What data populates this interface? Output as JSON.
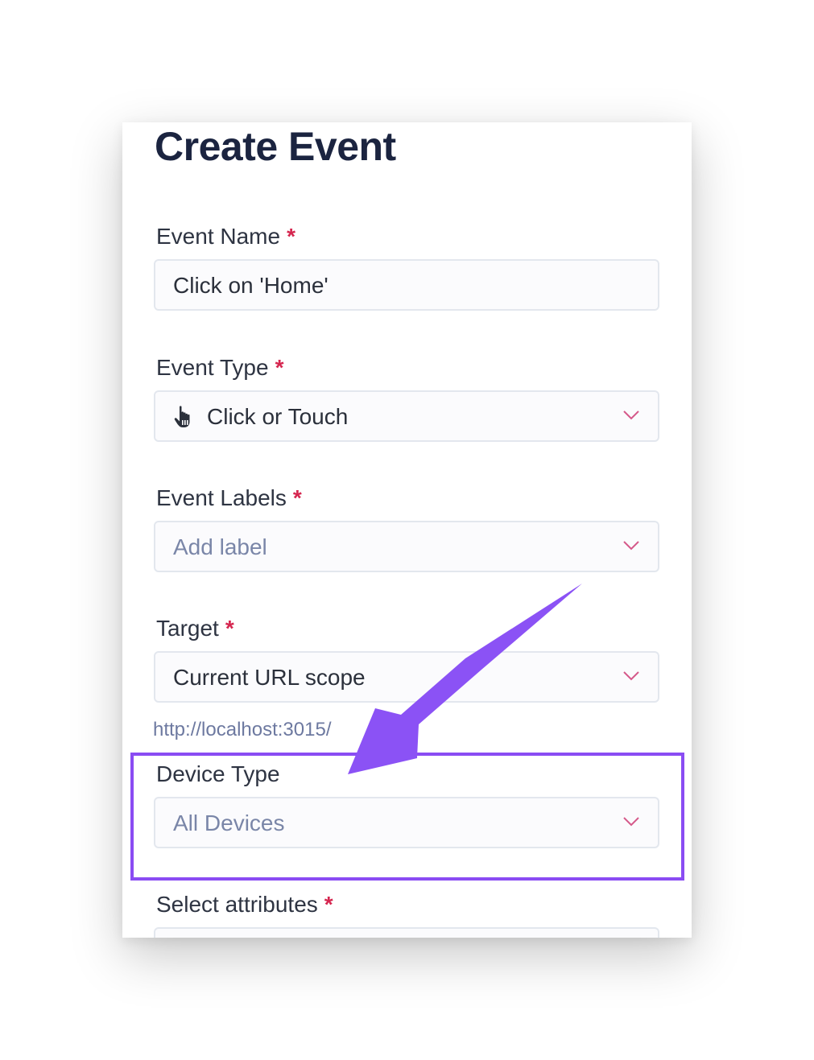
{
  "form": {
    "title": "Create Event",
    "required_marker": "*",
    "event_name": {
      "label": "Event Name",
      "value": "Click on 'Home'"
    },
    "event_type": {
      "label": "Event Type",
      "value": "Click or Touch",
      "icon": "pointer-hand-icon"
    },
    "event_labels": {
      "label": "Event Labels",
      "placeholder": "Add label"
    },
    "target": {
      "label": "Target",
      "value": "Current URL scope",
      "hint": "http://localhost:3015/"
    },
    "device_type": {
      "label": "Device Type",
      "value": "All Devices"
    },
    "select_attributes": {
      "label": "Select attributes"
    }
  },
  "annotation": {
    "highlight_color": "#8a4cf3",
    "arrow_color": "#8b52f5"
  },
  "colors": {
    "title": "#1b2440",
    "required": "#d5264f",
    "placeholder": "#7a86a8",
    "chevron": "#d5598a"
  }
}
